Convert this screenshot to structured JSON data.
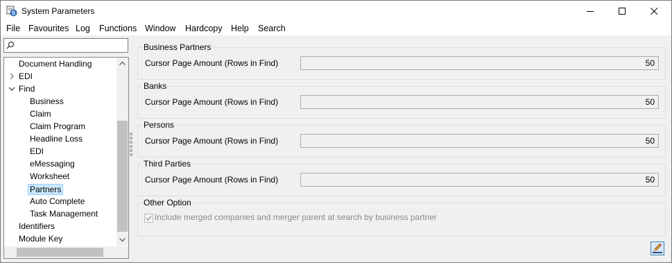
{
  "window": {
    "title": "System Parameters",
    "controls": [
      "minimize-icon",
      "maximize-icon",
      "close-icon"
    ]
  },
  "menu": [
    "File",
    "Favourites",
    "Log",
    "Functions",
    "Window",
    "Hardcopy",
    "Help",
    "Search"
  ],
  "search": {
    "value": "",
    "placeholder": ""
  },
  "tree": [
    {
      "label": "Document Handling",
      "level": 0
    },
    {
      "label": "EDI",
      "level": 0,
      "expander": "collapsed"
    },
    {
      "label": "Find",
      "level": 0,
      "expander": "expanded"
    },
    {
      "label": "Business",
      "level": 1
    },
    {
      "label": "Claim",
      "level": 1
    },
    {
      "label": "Claim Program",
      "level": 1
    },
    {
      "label": "Headline Loss",
      "level": 1
    },
    {
      "label": "EDI",
      "level": 1
    },
    {
      "label": "eMessaging",
      "level": 1
    },
    {
      "label": "Worksheet",
      "level": 1
    },
    {
      "label": "Partners",
      "level": 1,
      "selected": true
    },
    {
      "label": "Auto Complete",
      "level": 1
    },
    {
      "label": "Task Management",
      "level": 1
    },
    {
      "label": "Identifiers",
      "level": 0
    },
    {
      "label": "Module Key",
      "level": 0
    }
  ],
  "groups": [
    {
      "title": "Business Partners",
      "label": "Cursor Page Amount (Rows in Find)",
      "value": "50"
    },
    {
      "title": "Banks",
      "label": "Cursor Page Amount (Rows in Find)",
      "value": "50"
    },
    {
      "title": "Persons",
      "label": "Cursor Page Amount (Rows in Find)",
      "value": "50"
    },
    {
      "title": "Third Parties",
      "label": "Cursor Page Amount (Rows in Find)",
      "value": "50"
    }
  ],
  "other": {
    "title": "Other Option",
    "checkbox_label": "Include merged companies and merger parent at search by business partner",
    "checked": true,
    "enabled": false
  },
  "colors": {
    "selection": "#cce8ff",
    "app_icon": "#2b6cb5",
    "edit_icon": "#f0a030"
  },
  "icons": {
    "app": "system-parameters-app-icon",
    "edit": "edit-pencil-icon",
    "search": "search-icon"
  }
}
